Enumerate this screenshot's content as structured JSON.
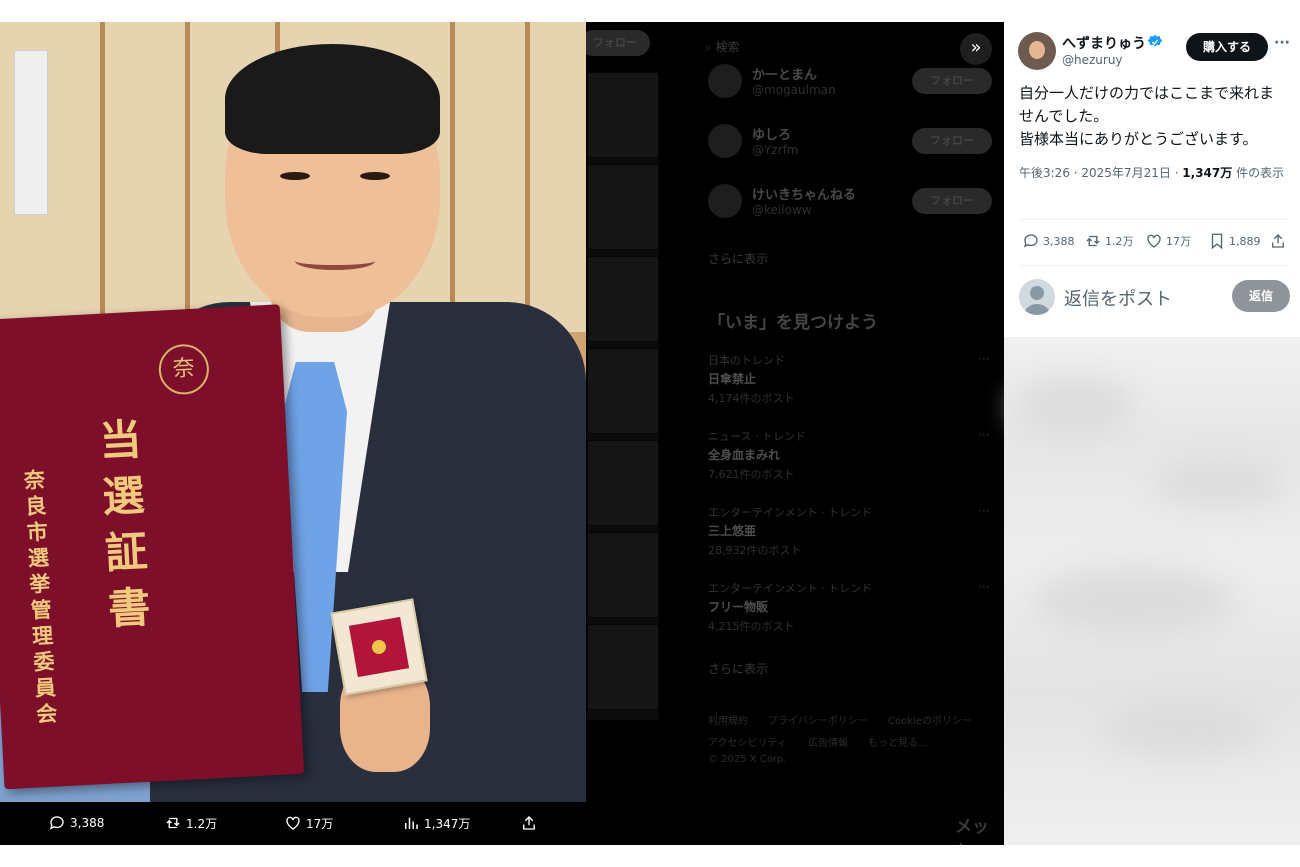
{
  "post": {
    "author_name": "へずまりゅう",
    "author_handle": "@hezuruy",
    "buy_label": "購入する",
    "more_label": "···",
    "text_lines": [
      "自分一人だけの力ではここまで来れま",
      "せんでした。",
      "皆様本当にありがとうございます。"
    ],
    "time": "午後3:26 · 2025年7月21日 · ",
    "views_value": "1,347万",
    "views_suffix": " 件の表示",
    "stats": {
      "replies": "3,388",
      "reposts": "1.2万",
      "likes": "17万",
      "bookmarks": "1,889"
    }
  },
  "reply": {
    "placeholder": "返信をポスト",
    "button_label": "返信"
  },
  "photo_bar": {
    "replies": "3,388",
    "reposts": "1.2万",
    "likes": "17万",
    "views": "1,347万"
  },
  "photo": {
    "certificate_emblem": "奈",
    "certificate_title": [
      "当",
      "選",
      "証",
      "書"
    ],
    "certificate_issuer": [
      "奈",
      "良",
      "市",
      "選",
      "挙",
      "管",
      "理",
      "委",
      "員",
      "会"
    ]
  },
  "background": {
    "follow_top": "フォロー",
    "search_placeholder": "検索",
    "suggestions": [
      {
        "name": "かーとまん",
        "handle": "@mogaulman",
        "follow": "フォロー"
      },
      {
        "name": "ゆしろ",
        "handle": "@Yzrfm",
        "follow": "フォロー"
      },
      {
        "name": "けいきちゃんねる",
        "handle": "@keiloww",
        "follow": "フォロー"
      }
    ],
    "show_more": "さらに表示",
    "explore_title": "「いま」を見つけよう",
    "trends": [
      {
        "category": "日本のトレンド",
        "name": "日傘禁止",
        "count": "4,174件のポスト"
      },
      {
        "category": "ニュース · トレンド",
        "name": "全身血まみれ",
        "count": "7,621件のポスト"
      },
      {
        "category": "エンターテインメント · トレンド",
        "name": "三上悠亜",
        "count": "28,932件のポスト"
      },
      {
        "category": "エンターテインメント · トレンド",
        "name": "フリー物販",
        "count": "4,215件のポスト"
      }
    ],
    "show_more2": "さらに表示",
    "footer_links": [
      "利用規約",
      "プライバシーポリシー",
      "Cookieのポリシー",
      "アクセシビリティ",
      "広告情報",
      "もっと見る…",
      "© 2025 X Corp."
    ],
    "messages": "メッセ"
  },
  "colors": {
    "verified": "#1d9bf0",
    "accent_dark": "#0f1419",
    "muted": "#536471"
  },
  "icons": [
    "collapse-icon",
    "reply-icon",
    "repost-icon",
    "like-icon",
    "views-icon",
    "bookmark-icon",
    "share-icon",
    "verified-icon",
    "more-icon"
  ]
}
